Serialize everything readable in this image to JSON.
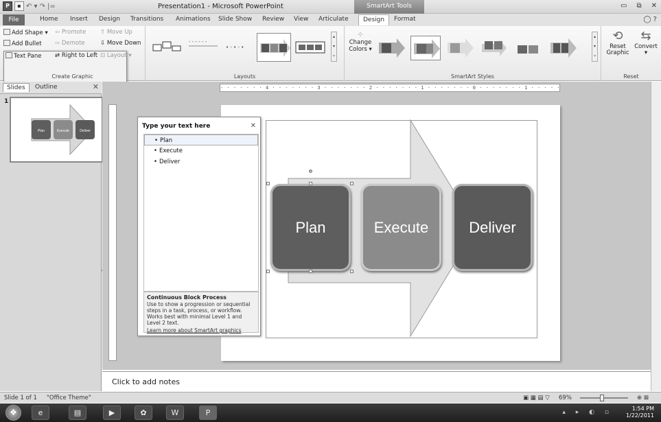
{
  "window": {
    "title": "Presentation1 - Microsoft PowerPoint",
    "contextual_header": "SmartArt Tools",
    "controls": [
      "▭",
      "⧉",
      "✕"
    ]
  },
  "qat": {
    "app_icon": "P",
    "save": "▪",
    "undo": "↶ ▾",
    "redo": "↷",
    "customize": "|="
  },
  "tabs": {
    "file": "File",
    "items": [
      "Home",
      "Insert",
      "Design",
      "Transitions",
      "Animations",
      "Slide Show",
      "Review",
      "View",
      "Articulate"
    ],
    "contextual": [
      "Design",
      "Format"
    ],
    "active": "Design",
    "help": "◯ ?"
  },
  "ribbon": {
    "create_graphic": {
      "label": "Create Graphic",
      "add_shape": "Add Shape ▾",
      "add_bullet": "Add Bullet",
      "text_pane": "Text Pane",
      "promote": "Promote",
      "demote": "Demote",
      "right_to_left": "Right to Left",
      "move_up": "Move Up",
      "move_down": "Move Down",
      "layout": "Layout ▾"
    },
    "layouts": {
      "label": "Layouts"
    },
    "smartart_styles": {
      "label": "SmartArt Styles",
      "change_colors": "Change Colors ▾"
    },
    "reset": {
      "label": "Reset",
      "reset_graphic": "Reset Graphic",
      "convert": "Convert ▾"
    }
  },
  "left_pane": {
    "tabs": [
      "Slides",
      "Outline"
    ],
    "active_tab": "Slides",
    "close": "✕",
    "slide_number": "1",
    "thumb_labels": [
      "Plan",
      "Execute",
      "Deliver"
    ]
  },
  "ruler": {
    "marks": "· · · · · · · 4 · · · · · · · 3 · · · · · · · 2 · · · · · · · 1 · · · · · · · 0 · · · · · · · 1 · · · · · · · 2 · · · · · · · 3 · · · · · · · 4 · · · · · · ·"
  },
  "text_pane": {
    "title": "Type your text here",
    "close": "✕",
    "items": [
      "Plan",
      "Execute",
      "Deliver"
    ],
    "info_title": "Continuous Block Process",
    "info_desc": "Use to show a progression or sequential steps in a task, process, or workflow. Works best with minimal Level 1 and Level 2 text.",
    "info_link": "Learn more about SmartArt graphics"
  },
  "smartart": {
    "blocks": [
      "Plan",
      "Execute",
      "Deliver"
    ]
  },
  "notes": {
    "placeholder": "Click to add notes"
  },
  "status_bar": {
    "slide_info": "Slide 1 of 1",
    "theme": "\"Office Theme\"",
    "zoom": "69%",
    "views": "▣ ▦ ▤ ▽"
  },
  "taskbar": {
    "start": "❖",
    "buttons": [
      "e",
      "▤",
      "▶",
      "✿",
      "W",
      "P"
    ],
    "tray_icons": "▴ ▸ ◐ ▫",
    "time": "1:54 PM",
    "date": "1/22/2011"
  }
}
